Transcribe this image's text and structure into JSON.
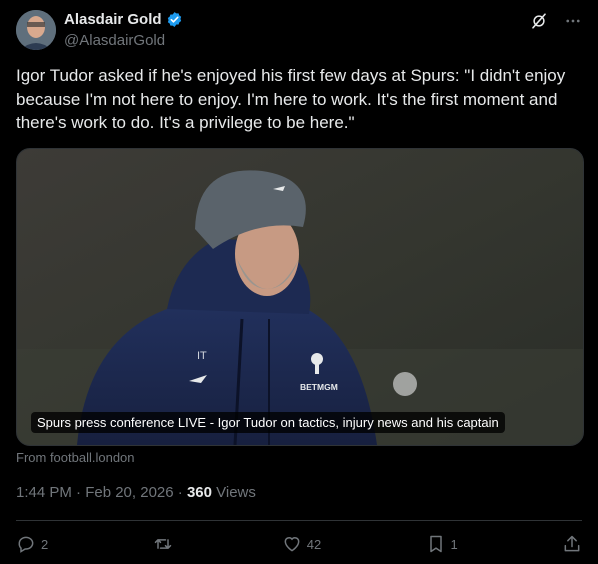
{
  "author": {
    "display_name": "Alasdair Gold",
    "handle": "@AlasdairGold",
    "verified_color": "#1d9bf0"
  },
  "icons": {
    "top": [
      "grok-icon",
      "more-icon"
    ],
    "actions": [
      "reply-icon",
      "retweet-icon",
      "like-icon",
      "bookmark-icon",
      "share-icon"
    ]
  },
  "tweet": {
    "text": "Igor Tudor asked if he's enjoyed his first few days at Spurs: \"I didn't enjoy because I'm not here to enjoy. I'm here to work. It's the first moment and there's work to do. It's a privilege to be here.\""
  },
  "media": {
    "caption": "Spurs press conference LIVE - Igor Tudor on tactics, injury news and his captain",
    "source": "From football.london",
    "jacket_initials": "IT",
    "sponsor_text": "BETMGM"
  },
  "meta": {
    "timestamp": "1:44 PM · Feb 20, 2026 · ",
    "views_count": "360",
    "views_label": " Views"
  },
  "actions": {
    "replies": "2",
    "retweets": "",
    "likes": "42",
    "bookmarks": "1"
  },
  "colors": {
    "background": "#000000",
    "text": "#e7e9ea",
    "muted": "#71767b",
    "border": "#2f3336"
  }
}
